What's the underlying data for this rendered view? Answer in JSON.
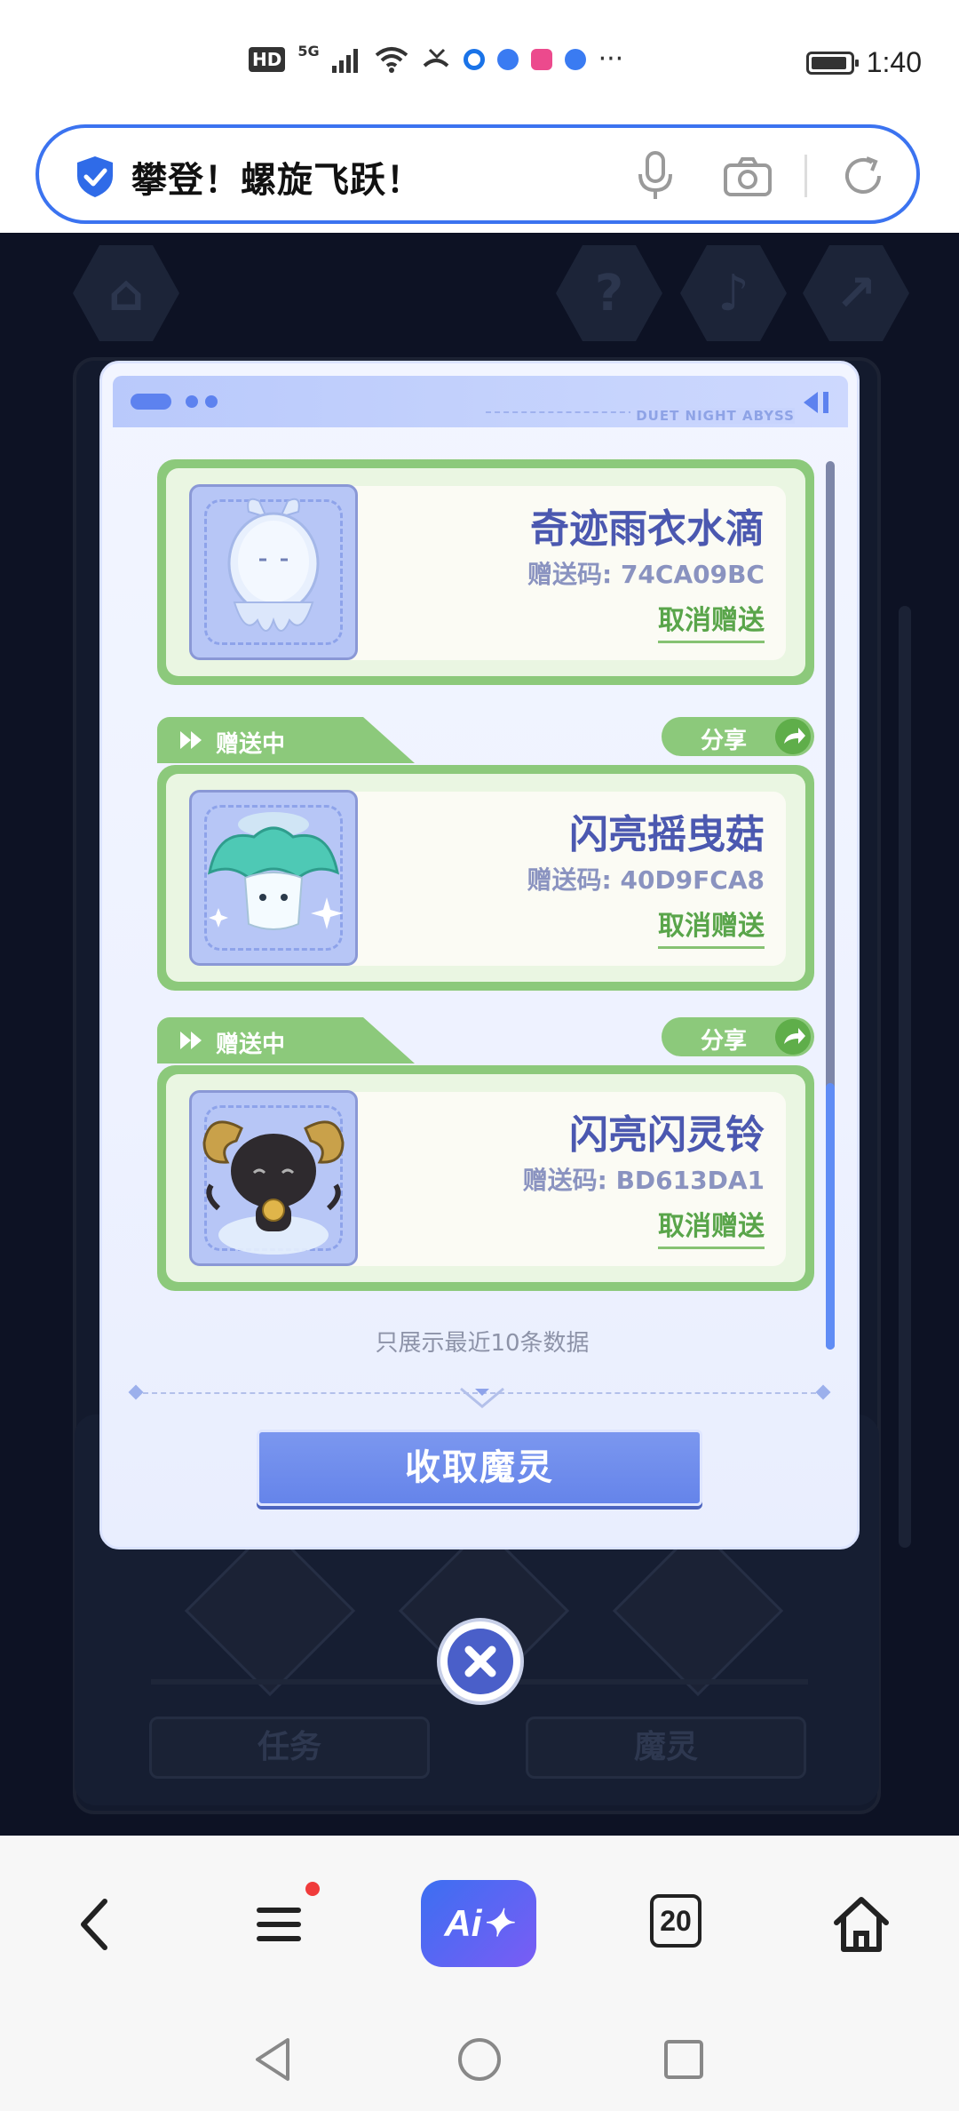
{
  "status_bar": {
    "hd_badge": "HD",
    "network": "5G",
    "time": "1:40",
    "ellipsis": "···",
    "icons": [
      "hd-icon",
      "signal-icon",
      "wifi-icon",
      "missed-call-icon",
      "app-notification-icon",
      "app-notification-icon",
      "bilibili-icon",
      "app-notification-icon",
      "battery-icon"
    ]
  },
  "address_bar": {
    "title": "攀登！螺旋飞跃！",
    "icons": [
      "shield-icon",
      "microphone-icon",
      "camera-icon",
      "reload-icon"
    ]
  },
  "modal": {
    "brand_text": "DUET NIGHT ABYSS",
    "items": [
      {
        "tab_label": "",
        "share_label": "",
        "name": "奇迹雨衣水滴",
        "code": "赠送码: 74CA09BC",
        "cancel_label": "取消赠送",
        "image": "raindrop-spirit"
      },
      {
        "tab_label": "赠送中",
        "share_label": "分享",
        "name": "闪亮摇曳菇",
        "code": "赠送码: 40D9FCA8",
        "cancel_label": "取消赠送",
        "image": "mushroom-spirit"
      },
      {
        "tab_label": "赠送中",
        "share_label": "分享",
        "name": "闪亮闪灵铃",
        "code": "赠送码: BD613DA1",
        "cancel_label": "取消赠送",
        "image": "goat-bell-spirit"
      }
    ],
    "footnote": "只展示最近10条数据",
    "collect_button": "收取魔灵"
  },
  "background": {
    "tab_task": "任务",
    "tab_spirit": "魔灵",
    "hex_icons": [
      "home-icon",
      "help-icon",
      "music-icon",
      "share-icon"
    ]
  },
  "toolbar": {
    "ai_label": "Ai✦",
    "tab_count": "20",
    "icons": [
      "back-icon",
      "menu-icon",
      "ai-assistant-icon",
      "tabs-icon",
      "home-icon"
    ]
  },
  "nav_bar": {
    "icons": [
      "nav-back-icon",
      "nav-home-icon",
      "nav-recents-icon"
    ]
  },
  "colors": {
    "accent": "#3b73f0",
    "card_green": "#8cc97b",
    "name_blue": "#4b58b0",
    "button_blue": "#6584ea",
    "notification_red": "#f03b3b"
  }
}
